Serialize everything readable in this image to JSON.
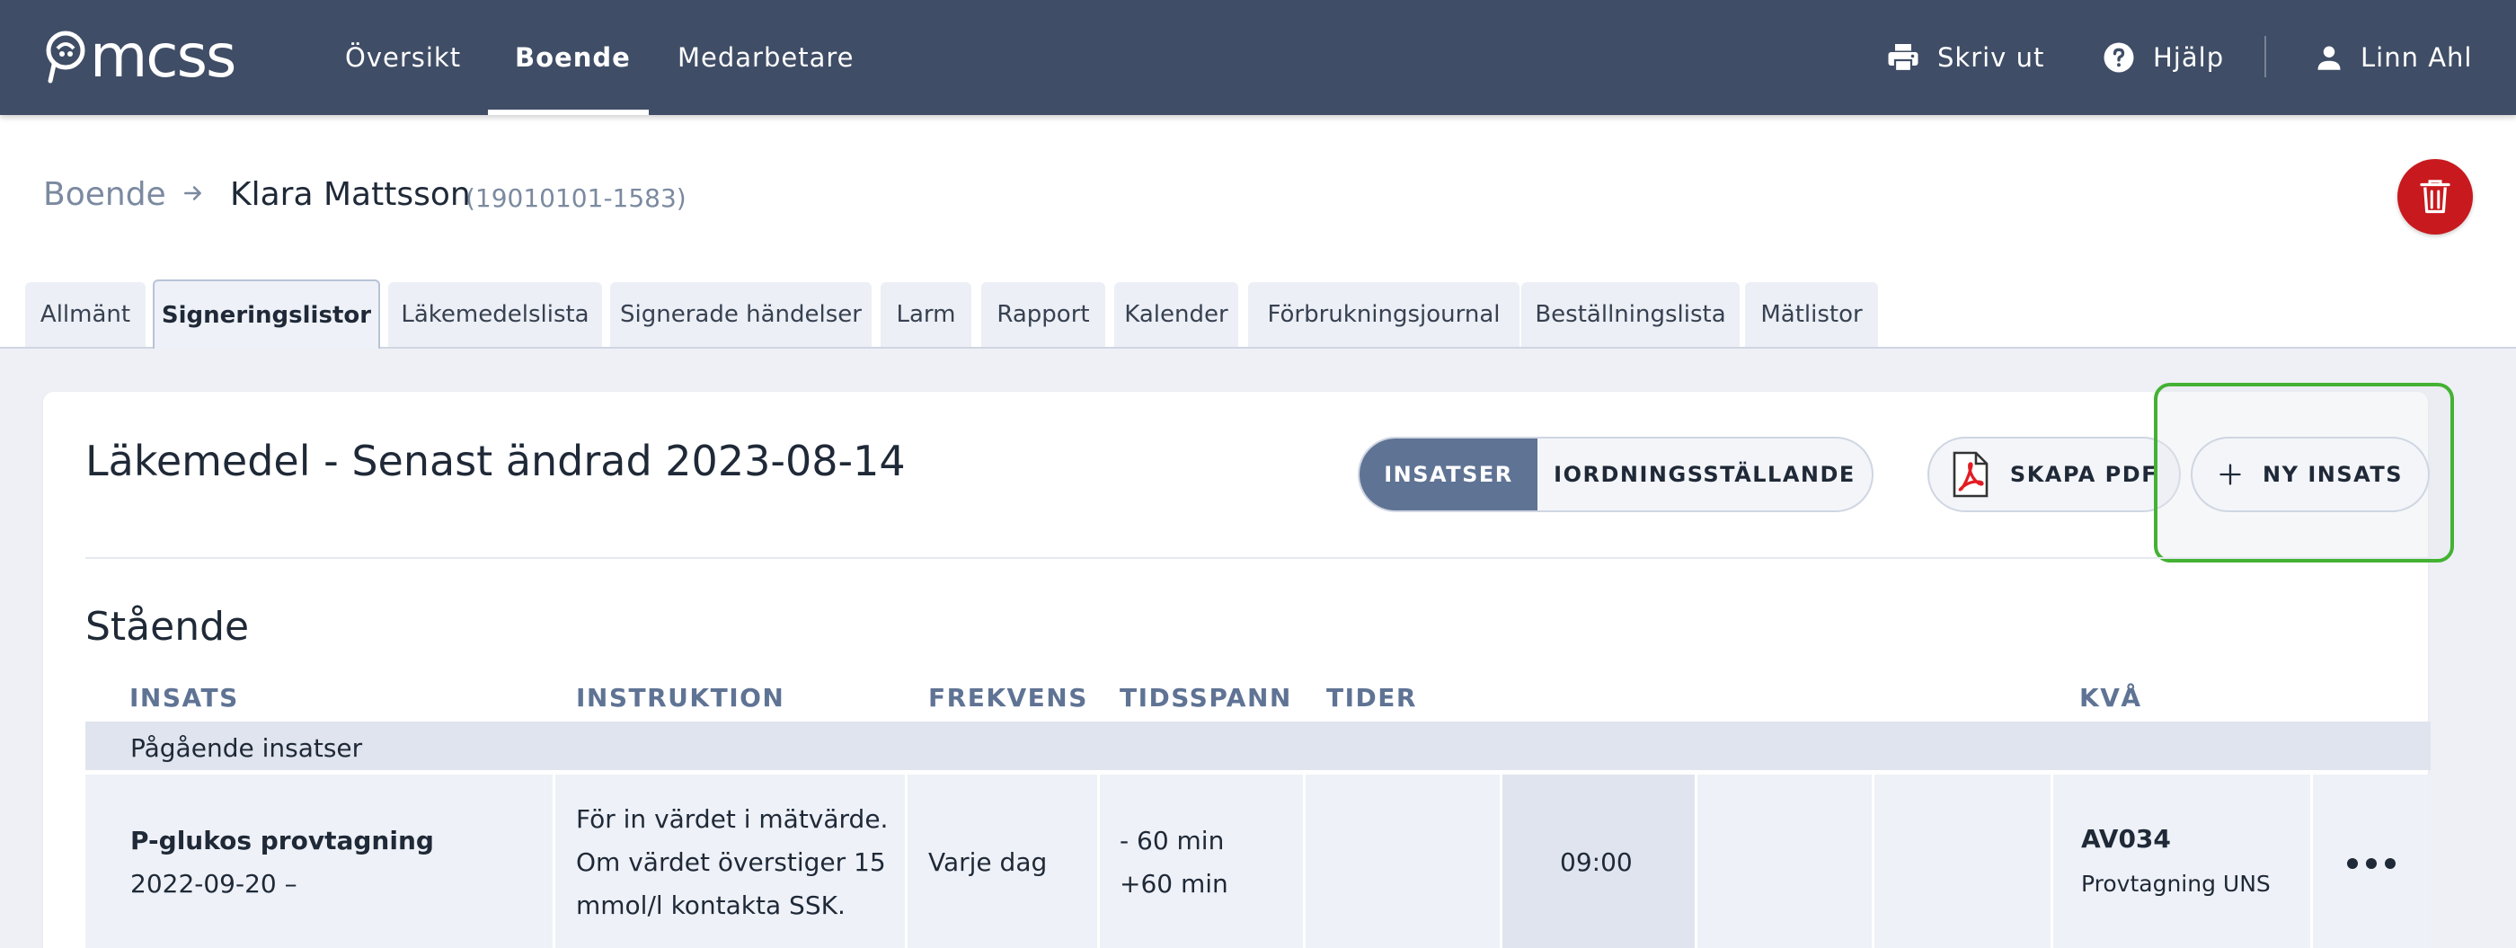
{
  "app": {
    "logo_text": "mcss"
  },
  "nav": {
    "items": [
      {
        "label": "Översikt"
      },
      {
        "label": "Boende"
      },
      {
        "label": "Medarbetare"
      }
    ],
    "active": "Boende",
    "print_label": "Skriv ut",
    "help_label": "Hjälp",
    "user_name": "Linn Ahl"
  },
  "breadcrumb": {
    "root": "Boende",
    "name": "Klara Mattsson",
    "pnr": "(19010101-1583)"
  },
  "tabs": [
    {
      "label": "Allmänt"
    },
    {
      "label": "Signeringslistor"
    },
    {
      "label": "Läkemedelslista"
    },
    {
      "label": "Signerade händelser"
    },
    {
      "label": "Larm"
    },
    {
      "label": "Rapport"
    },
    {
      "label": "Kalender"
    },
    {
      "label": "Förbrukningsjournal"
    },
    {
      "label": "Beställningslista"
    },
    {
      "label": "Mätlistor"
    }
  ],
  "active_tab": "Signeringslistor",
  "card": {
    "title": "Läkemedel - Senast ändrad 2023-08-14",
    "segment": {
      "active": "INSATSER",
      "other": "IORDNINGSSTÄLLANDE"
    },
    "pdf_label": "SKAPA PDF",
    "new_label": "NY INSATS"
  },
  "section": {
    "title": "Stående",
    "columns": {
      "insats": "INSATS",
      "instruktion": "INSTRUKTION",
      "frekvens": "FREKVENS",
      "tidsspann": "TIDSSPANN",
      "tider": "TIDER",
      "kva": "KVÅ"
    },
    "group": "Pågående insatser",
    "rows": [
      {
        "insats": "P-glukos provtagning",
        "date": "2022-09-20 –",
        "instruktion": [
          "För in värdet i mätvärde.",
          "Om värdet överstiger 15",
          "mmol/l kontakta SSK."
        ],
        "frekvens": "Varje dag",
        "tidsspann": [
          "- 60 min",
          "+60 min"
        ],
        "time": "09:00",
        "kva_code": "AV034",
        "kva_desc": "Provtagning UNS"
      }
    ]
  },
  "colors": {
    "topbar": "#3f4d66",
    "accent": "#5f7394",
    "delete": "#c8191e",
    "highlight": "#43b233"
  },
  "icons": {
    "print": "printer-icon",
    "help": "question-circle-icon",
    "user": "user-icon",
    "delete": "trash-icon",
    "pdf": "pdf-icon",
    "add": "plus-icon",
    "more": "more-horizontal-icon",
    "breadcrumb": "arrow-right-icon"
  }
}
